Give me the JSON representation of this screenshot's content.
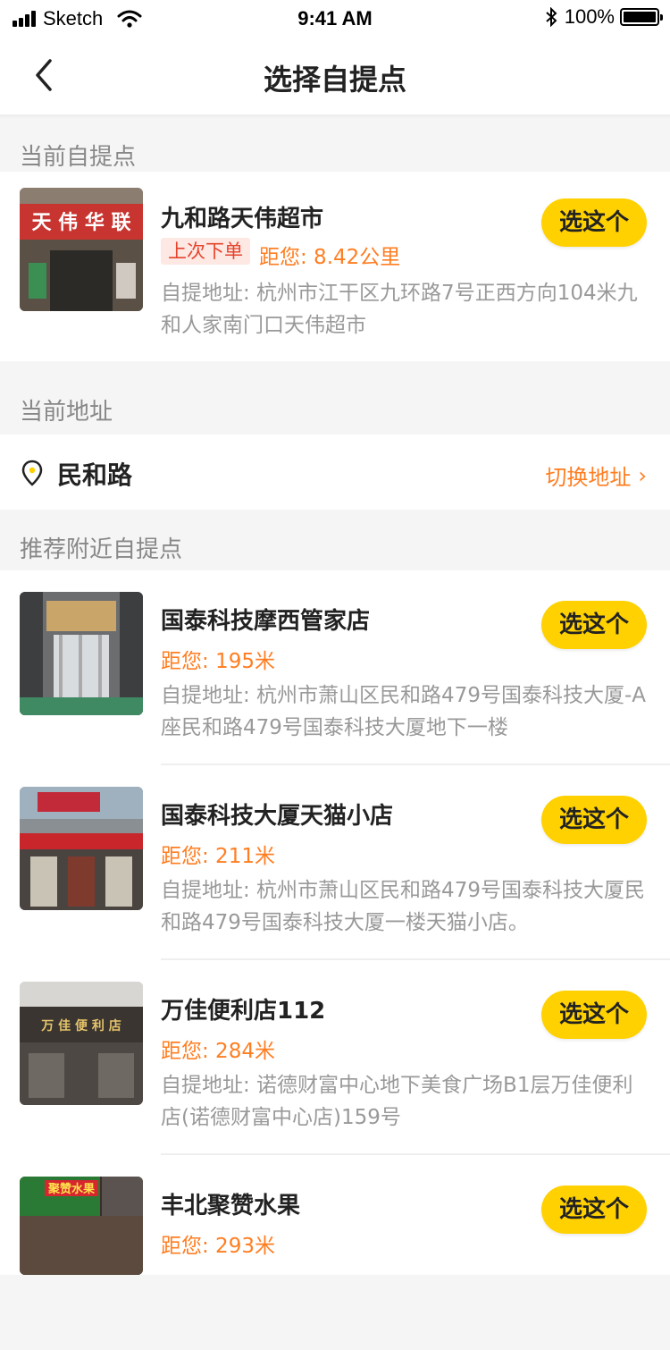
{
  "status_bar": {
    "carrier": "Sketch",
    "time": "9:41 AM",
    "battery": "100%",
    "battery_level": 1.0
  },
  "nav": {
    "title": "选择自提点",
    "back_icon": "chevron-left-icon"
  },
  "current_pickup": {
    "section_label": "当前自提点",
    "name": "九和路天伟超市",
    "tag": "上次下单",
    "distance": "距您: 8.42公里",
    "address": "自提地址: 杭州市江干区九环路7号正西方向104米九和人家南门口天伟超市",
    "button": "选这个",
    "sign_text": "天 伟 华 联"
  },
  "current_address": {
    "section_label": "当前地址",
    "name": "民和路",
    "switch_label": "切换地址",
    "pin_icon": "location-pin-icon",
    "chevron": "›"
  },
  "recommended": {
    "section_label": "推荐附近自提点",
    "items": [
      {
        "name": "国泰科技摩西管家店",
        "distance": "距您: 195米",
        "address": "自提地址: 杭州市萧山区民和路479号国泰科技大厦-A座民和路479号国泰科技大厦地下一楼",
        "button": "选这个"
      },
      {
        "name": "国泰科技大厦天猫小店",
        "distance": "距您: 211米",
        "address": "自提地址: 杭州市萧山区民和路479号国泰科技大厦民和路479号国泰科技大厦一楼天猫小店。",
        "button": "选这个"
      },
      {
        "name": "万佳便利店112",
        "distance": "距您: 284米",
        "address": "自提地址: 诺德财富中心地下美食广场B1层万佳便利店(诺德财富中心店)159号",
        "button": "选这个",
        "sign_text": "万 佳 便 利 店"
      },
      {
        "name": "丰北聚赞水果",
        "distance": "距您: 293米",
        "address": "",
        "button": "选这个",
        "sign_text": "聚赞水果"
      }
    ]
  },
  "colors": {
    "accent_yellow": "#ffd100",
    "orange": "#ff7e22",
    "tag_red": "#e5442c",
    "gray_text": "#999999"
  }
}
